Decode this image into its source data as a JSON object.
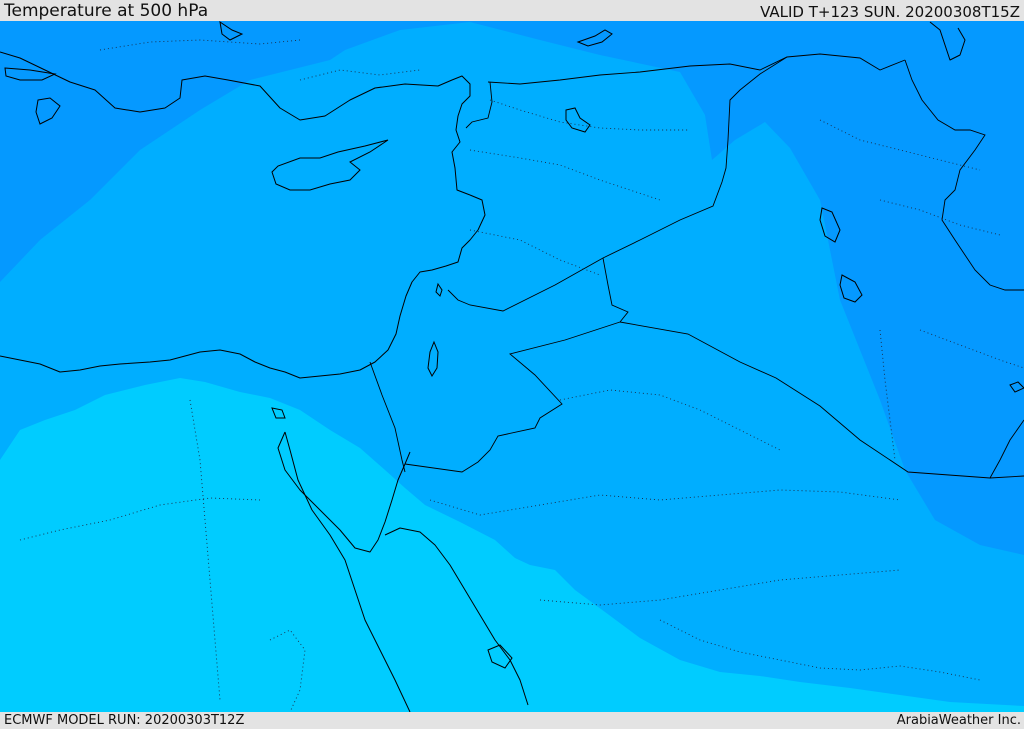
{
  "header": {
    "title": "Temperature at 500 hPa",
    "valid": "VALID T+123 SUN. 20200308T15Z"
  },
  "footer": {
    "model_run": "ECMWF MODEL RUN: 20200303T12Z",
    "credit": "ArabiaWeather Inc."
  },
  "map": {
    "field_colors": {
      "cold": "#0599ff",
      "mid": "#00aeff",
      "warm": "#00ccff"
    },
    "boundary_color": "#000000"
  }
}
